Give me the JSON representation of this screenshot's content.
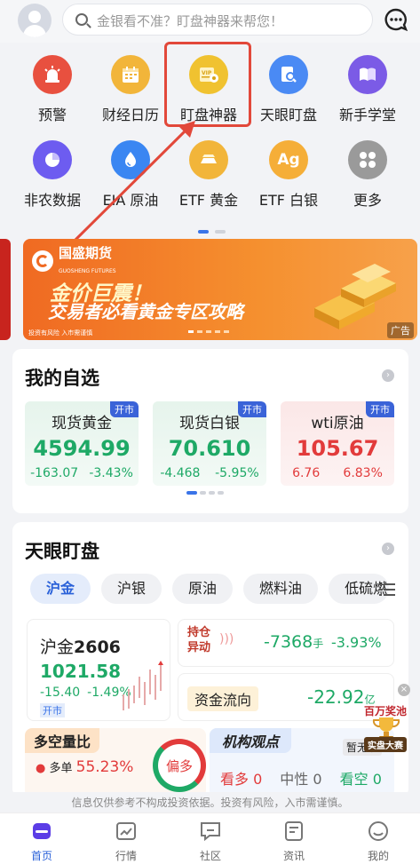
{
  "search": {
    "placeholder": "金银看不准？盯盘神器来帮您！"
  },
  "grid_row1": [
    {
      "label": "预警",
      "icon": "alarm-icon",
      "color": "#e8503f"
    },
    {
      "label": "财经日历",
      "icon": "calendar-icon",
      "color": "#f2b53a"
    },
    {
      "label": "盯盘神器",
      "icon": "vip-eye-icon",
      "color": "#f0c230"
    },
    {
      "label": "天眼盯盘",
      "icon": "search-doc-icon",
      "color": "#4a8af4"
    },
    {
      "label": "新手学堂",
      "icon": "book-icon",
      "color": "#7b5be6"
    }
  ],
  "grid_row2": [
    {
      "label": "非农数据",
      "icon": "pie-icon",
      "color": "#6d5cf0"
    },
    {
      "label": "EIA 原油",
      "icon": "oil-drop-icon",
      "color": "#3a86f2"
    },
    {
      "label": "ETF 黄金",
      "icon": "gold-bar-icon",
      "color": "#f2b53a"
    },
    {
      "label": "ETF 白银",
      "icon": "ag-icon",
      "color": "#f5ae38"
    },
    {
      "label": "更多",
      "icon": "more-grid-icon",
      "color": "#9a9a9a"
    }
  ],
  "banner": {
    "brand": "国盛期货",
    "brand_en": "GUOSHENG FUTURES",
    "headline1": "金价巨震！",
    "headline2": "交易者必看黄金专区攻略",
    "risk": "投资有风险 入市需谨慎",
    "ad": "广告"
  },
  "watchlist": {
    "title": "我的自选",
    "items": [
      {
        "name": "现货黄金",
        "price": "4594.99",
        "change": "-163.07",
        "pct": "-3.43%",
        "tag": "开市",
        "trend": "down"
      },
      {
        "name": "现货白银",
        "price": "70.610",
        "change": "-4.468",
        "pct": "-5.95%",
        "tag": "开市",
        "trend": "down"
      },
      {
        "name": "wti原油",
        "price": "105.67",
        "change": "6.76",
        "pct": "6.83%",
        "tag": "开市",
        "trend": "up"
      }
    ]
  },
  "tianyan": {
    "title": "天眼盯盘",
    "tabs": [
      "沪金",
      "沪银",
      "原油",
      "燃料油",
      "低硫燃"
    ],
    "quote": {
      "name": "沪金",
      "code": "2606",
      "price": "1021.58",
      "change": "-15.40",
      "pct": "-1.49%",
      "tag": "开市"
    },
    "holding": {
      "label1": "持仓",
      "label2": "异动",
      "value": "-7368",
      "unit": "手",
      "pct": "-3.93%"
    },
    "flow": {
      "label": "资金流向",
      "value": "-22.92",
      "unit": "亿"
    },
    "longshort": {
      "title": "多空量比",
      "long_label": "多单",
      "long_pct": "55.23%",
      "badge": "偏多"
    },
    "views": {
      "title": "机构观点",
      "bull": "看多",
      "bull_n": "0",
      "neutral": "中性",
      "neutral_n": "0",
      "bear": "看空",
      "bear_n": "0",
      "tag": "暂无观"
    },
    "float_badge": {
      "line1": "百万奖池",
      "line2": "实盘大赛"
    }
  },
  "disclaimer": "信息仅供参考不构成投资依据。投资有风险，入市需谨慎。",
  "tabbar": [
    {
      "label": "首页",
      "icon": "home-icon"
    },
    {
      "label": "行情",
      "icon": "chart-icon"
    },
    {
      "label": "社区",
      "icon": "community-icon"
    },
    {
      "label": "资讯",
      "icon": "news-icon"
    },
    {
      "label": "我的",
      "icon": "profile-icon"
    }
  ]
}
